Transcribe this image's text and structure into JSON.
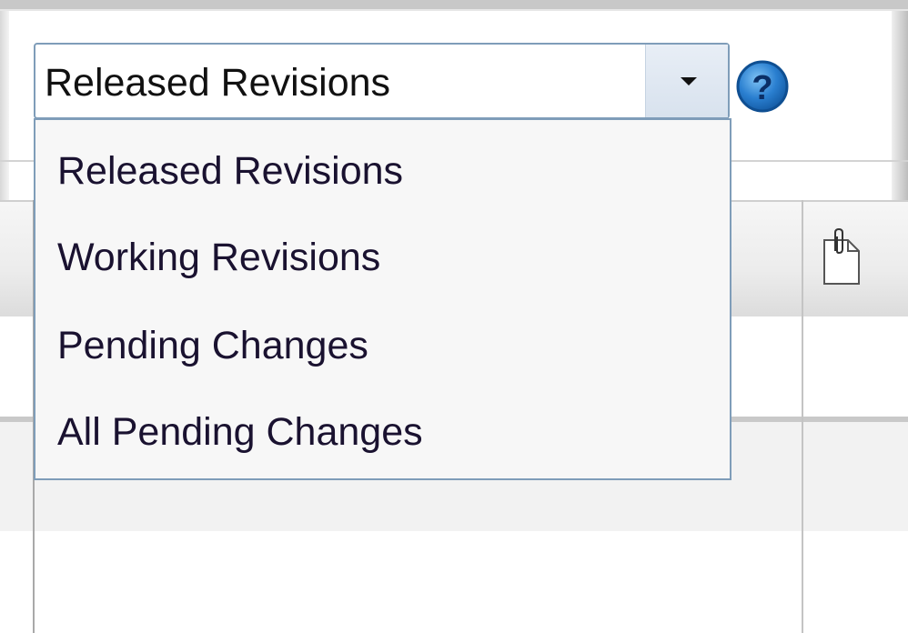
{
  "revision_filter": {
    "selected_value": "Released Revisions",
    "options": [
      "Released Revisions",
      "Working Revisions",
      "Pending Changes",
      "All Pending Changes"
    ],
    "expanded": true
  },
  "help_icon": {
    "symbol": "?",
    "color": "#2a7fd0"
  },
  "colors": {
    "combo_border": "#7f9db9",
    "dropdown_background": "#f7f7f7"
  }
}
